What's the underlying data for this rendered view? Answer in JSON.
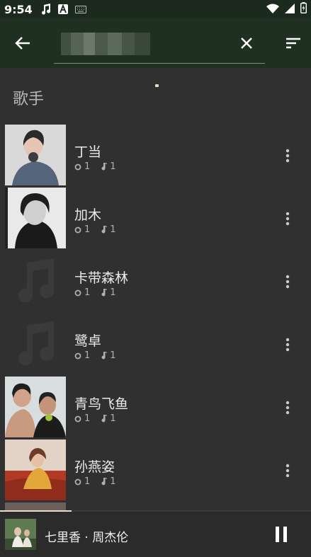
{
  "status": {
    "time": "9:54",
    "icons": [
      "music-note-icon",
      "font-a-icon",
      "keyboard-icon"
    ],
    "right_icons": [
      "wifi-icon",
      "signal-icon",
      "battery-icon"
    ]
  },
  "toolbar": {
    "back_icon": "arrow-left-icon",
    "search_value": "",
    "clear_icon": "close-icon",
    "sort_icon": "sort-icon"
  },
  "section": {
    "title": "歌手"
  },
  "artists": [
    {
      "name": "丁当",
      "albums": "1",
      "songs": "1",
      "has_photo": true
    },
    {
      "name": "加木",
      "albums": "1",
      "songs": "1",
      "has_photo": true
    },
    {
      "name": "卡带森林",
      "albums": "1",
      "songs": "1",
      "has_photo": false
    },
    {
      "name": "鹭卓",
      "albums": "1",
      "songs": "1",
      "has_photo": false
    },
    {
      "name": "青鸟飞鱼",
      "albums": "1",
      "songs": "1",
      "has_photo": true
    },
    {
      "name": "孙燕姿",
      "albums": "1",
      "songs": "1",
      "has_photo": true
    }
  ],
  "now_playing": {
    "title": "七里香 · 周杰伦",
    "progress": 0.23,
    "control_icon": "pause-icon"
  },
  "colors": {
    "toolbar": "#1f3021",
    "background": "#303030",
    "progress": "#e8dccb"
  }
}
